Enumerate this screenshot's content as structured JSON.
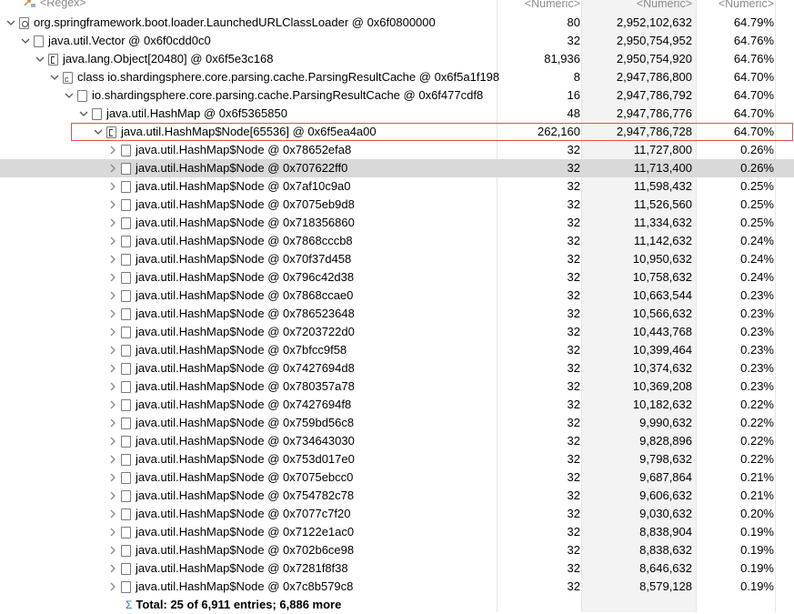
{
  "header": {
    "regex_placeholder": "<Regex>",
    "numeric_col1": "<Numeric>",
    "numeric_col2": "<Numeric>",
    "numeric_col3": "<Numeric>"
  },
  "tree": [
    {
      "label": "org.springframework.boot.loader.LaunchedURLClassLoader @ 0x6f0800000",
      "shallow": "80",
      "retained": "2,952,102,632",
      "percent": "64.79%",
      "icon": "loader-icon"
    },
    {
      "label": "java.util.Vector @ 0x6f0cdd0c0",
      "shallow": "32",
      "retained": "2,950,754,952",
      "percent": "64.76%",
      "icon": "file-icon"
    },
    {
      "label": "java.lang.Object[20480] @ 0x6f5e3c168",
      "shallow": "81,936",
      "retained": "2,950,754,920",
      "percent": "64.76%",
      "icon": "array-icon"
    },
    {
      "label": "class io.shardingsphere.core.parsing.cache.ParsingResultCache @ 0x6f5a1f198",
      "shallow": "8",
      "retained": "2,947,786,800",
      "percent": "64.70%",
      "icon": "class-icon"
    },
    {
      "label": "io.shardingsphere.core.parsing.cache.ParsingResultCache @ 0x6f477cdf8",
      "shallow": "16",
      "retained": "2,947,786,792",
      "percent": "64.70%",
      "icon": "file-icon"
    },
    {
      "label": "java.util.HashMap @ 0x6f5365850",
      "shallow": "48",
      "retained": "2,947,786,776",
      "percent": "64.70%",
      "icon": "file-icon"
    },
    {
      "label": "java.util.HashMap$Node[65536] @ 0x6f5ea4a00",
      "shallow": "262,160",
      "retained": "2,947,786,728",
      "percent": "64.70%",
      "icon": "array-icon"
    }
  ],
  "nodes": [
    {
      "label": "java.util.HashMap$Node @ 0x78652efa8",
      "shallow": "32",
      "retained": "11,727,800",
      "percent": "0.26%"
    },
    {
      "label": "java.util.HashMap$Node @ 0x707622ff0",
      "shallow": "32",
      "retained": "11,713,400",
      "percent": "0.26%"
    },
    {
      "label": "java.util.HashMap$Node @ 0x7af10c9a0",
      "shallow": "32",
      "retained": "11,598,432",
      "percent": "0.25%"
    },
    {
      "label": "java.util.HashMap$Node @ 0x7075eb9d8",
      "shallow": "32",
      "retained": "11,526,560",
      "percent": "0.25%"
    },
    {
      "label": "java.util.HashMap$Node @ 0x718356860",
      "shallow": "32",
      "retained": "11,334,632",
      "percent": "0.25%"
    },
    {
      "label": "java.util.HashMap$Node @ 0x7868cccb8",
      "shallow": "32",
      "retained": "11,142,632",
      "percent": "0.24%"
    },
    {
      "label": "java.util.HashMap$Node @ 0x70f37d458",
      "shallow": "32",
      "retained": "10,950,632",
      "percent": "0.24%"
    },
    {
      "label": "java.util.HashMap$Node @ 0x796c42d38",
      "shallow": "32",
      "retained": "10,758,632",
      "percent": "0.24%"
    },
    {
      "label": "java.util.HashMap$Node @ 0x7868ccae0",
      "shallow": "32",
      "retained": "10,663,544",
      "percent": "0.23%"
    },
    {
      "label": "java.util.HashMap$Node @ 0x786523648",
      "shallow": "32",
      "retained": "10,566,632",
      "percent": "0.23%"
    },
    {
      "label": "java.util.HashMap$Node @ 0x7203722d0",
      "shallow": "32",
      "retained": "10,443,768",
      "percent": "0.23%"
    },
    {
      "label": "java.util.HashMap$Node @ 0x7bfcc9f58",
      "shallow": "32",
      "retained": "10,399,464",
      "percent": "0.23%"
    },
    {
      "label": "java.util.HashMap$Node @ 0x7427694d8",
      "shallow": "32",
      "retained": "10,374,632",
      "percent": "0.23%"
    },
    {
      "label": "java.util.HashMap$Node @ 0x780357a78",
      "shallow": "32",
      "retained": "10,369,208",
      "percent": "0.23%"
    },
    {
      "label": "java.util.HashMap$Node @ 0x7427694f8",
      "shallow": "32",
      "retained": "10,182,632",
      "percent": "0.22%"
    },
    {
      "label": "java.util.HashMap$Node @ 0x759bd56c8",
      "shallow": "32",
      "retained": "9,990,632",
      "percent": "0.22%"
    },
    {
      "label": "java.util.HashMap$Node @ 0x734643030",
      "shallow": "32",
      "retained": "9,828,896",
      "percent": "0.22%"
    },
    {
      "label": "java.util.HashMap$Node @ 0x753d017e0",
      "shallow": "32",
      "retained": "9,798,632",
      "percent": "0.22%"
    },
    {
      "label": "java.util.HashMap$Node @ 0x7075ebcc0",
      "shallow": "32",
      "retained": "9,687,864",
      "percent": "0.21%"
    },
    {
      "label": "java.util.HashMap$Node @ 0x754782c78",
      "shallow": "32",
      "retained": "9,606,632",
      "percent": "0.21%"
    },
    {
      "label": "java.util.HashMap$Node @ 0x7077c7f20",
      "shallow": "32",
      "retained": "9,030,632",
      "percent": "0.20%"
    },
    {
      "label": "java.util.HashMap$Node @ 0x7122e1ac0",
      "shallow": "32",
      "retained": "8,838,904",
      "percent": "0.19%"
    },
    {
      "label": "java.util.HashMap$Node @ 0x702b6ce98",
      "shallow": "32",
      "retained": "8,838,632",
      "percent": "0.19%"
    },
    {
      "label": "java.util.HashMap$Node @ 0x7281f8f38",
      "shallow": "32",
      "retained": "8,646,632",
      "percent": "0.19%"
    },
    {
      "label": "java.util.HashMap$Node @ 0x7c8b579c8",
      "shallow": "32",
      "retained": "8,579,128",
      "percent": "0.19%"
    }
  ],
  "total": {
    "label": "Total: 25 of 6,911 entries; 6,886 more"
  },
  "colors": {
    "selection_border": "#d9534f",
    "selected_row": "#d9d9d9",
    "header_text": "#8a8a8a",
    "total_icon": "#3a6fb0"
  }
}
